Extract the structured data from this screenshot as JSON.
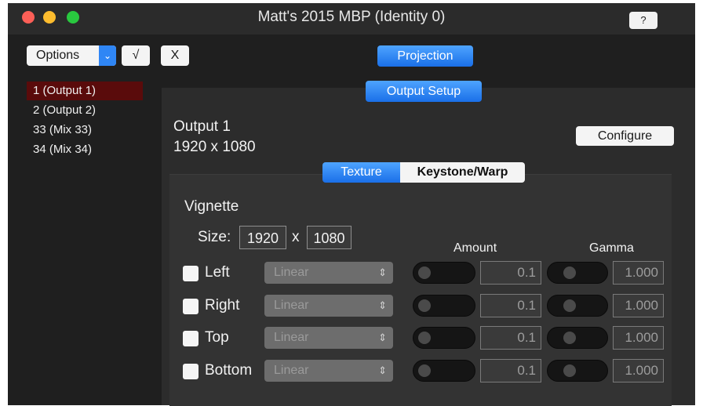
{
  "window": {
    "title": "Matt's 2015 MBP (Identity 0)",
    "help_label": "?"
  },
  "toolbar": {
    "options_label": "Options",
    "confirm_label": "√",
    "cancel_label": "X",
    "projection_label": "Projection"
  },
  "sidebar": {
    "items": [
      {
        "label": "1 (Output 1)",
        "selected": true
      },
      {
        "label": "2 (Output 2)",
        "selected": false
      },
      {
        "label": "33 (Mix 33)",
        "selected": false
      },
      {
        "label": "34 (Mix 34)",
        "selected": false
      }
    ]
  },
  "output": {
    "setup_label": "Output Setup",
    "name": "Output 1",
    "resolution": "1920 x 1080",
    "configure_label": "Configure"
  },
  "tabs": [
    {
      "label": "Texture",
      "active": true
    },
    {
      "label": "Keystone/Warp",
      "active": false
    }
  ],
  "vignette": {
    "heading": "Vignette",
    "size_label": "Size:",
    "width": "1920",
    "by": "x",
    "height": "1080",
    "amount_header": "Amount",
    "gamma_header": "Gamma",
    "rows": [
      {
        "label": "Left",
        "mode": "Linear",
        "amount": "0.1",
        "gamma": "1.000"
      },
      {
        "label": "Right",
        "mode": "Linear",
        "amount": "0.1",
        "gamma": "1.000"
      },
      {
        "label": "Top",
        "mode": "Linear",
        "amount": "0.1",
        "gamma": "1.000"
      },
      {
        "label": "Bottom",
        "mode": "Linear",
        "amount": "0.1",
        "gamma": "1.000"
      }
    ]
  },
  "colors": {
    "selection": "#5a0b0b",
    "accent_blue": "#2f86f5",
    "close": "#fc5f57",
    "minimize": "#fdbc2e",
    "zoom": "#29c83f"
  }
}
